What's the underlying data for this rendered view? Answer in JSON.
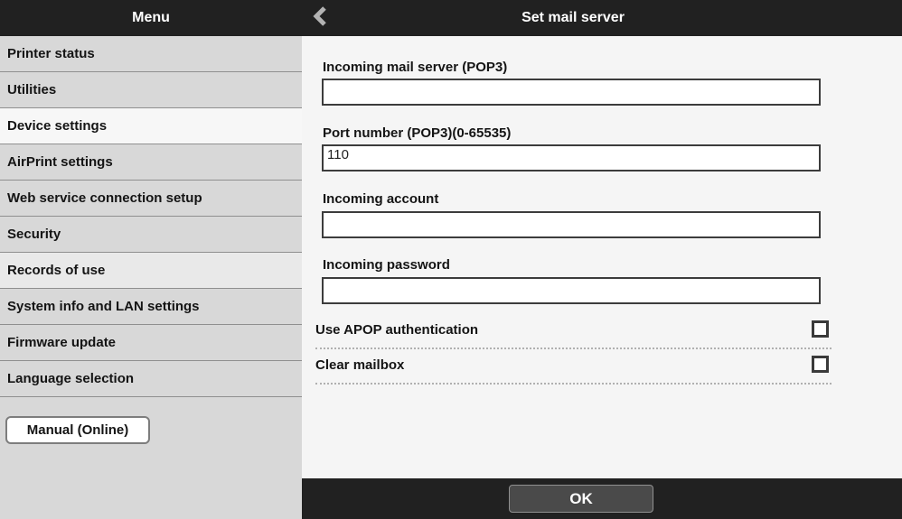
{
  "header": {
    "menu_title": "Menu",
    "page_title": "Set mail server"
  },
  "sidebar": {
    "items": [
      {
        "label": "Printer status",
        "state": "normal"
      },
      {
        "label": "Utilities",
        "state": "normal"
      },
      {
        "label": "Device settings",
        "state": "active"
      },
      {
        "label": "AirPrint settings",
        "state": "normal"
      },
      {
        "label": "Web service connection setup",
        "state": "normal"
      },
      {
        "label": "Security",
        "state": "normal"
      },
      {
        "label": "Records of use",
        "state": "highlight"
      },
      {
        "label": "System info and LAN settings",
        "state": "normal"
      },
      {
        "label": "Firmware update",
        "state": "normal"
      },
      {
        "label": "Language selection",
        "state": "normal"
      }
    ],
    "manual_button_label": "Manual (Online)"
  },
  "form": {
    "fields": [
      {
        "label": "Incoming mail server (POP3)",
        "value": ""
      },
      {
        "label": "Port number (POP3)(0-65535)",
        "value": "110"
      },
      {
        "label": "Incoming account",
        "value": ""
      },
      {
        "label": "Incoming password",
        "value": ""
      }
    ],
    "toggles": [
      {
        "label": "Use APOP authentication",
        "checked": false
      },
      {
        "label": "Clear mailbox",
        "checked": false
      }
    ],
    "ok_button_label": "OK"
  },
  "colors": {
    "header_bg": "#212121",
    "sidebar_item_bg": "#d8d8d8",
    "sidebar_active_bg": "#f7f7f7",
    "sidebar_highlight_bg": "#e9e9e9",
    "content_bg": "#f5f5f5",
    "input_border": "#3c3c3c",
    "ok_button_bg": "#4a4a4a"
  }
}
